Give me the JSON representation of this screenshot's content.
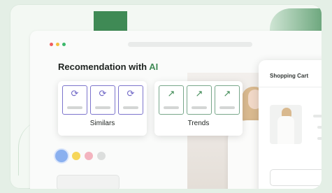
{
  "headline": {
    "prefix": "Recomendation with ",
    "accent": "AI"
  },
  "colors": {
    "accent": "#3f8a55",
    "tile_border": "#7c74cc",
    "refresh_icon": "#6f67c6",
    "trend_border": "#78a78a",
    "trend_icon": "#3f8a55",
    "dot_red": "#f05d5e",
    "dot_yellow": "#f4c13d",
    "dot_green": "#3bb86b"
  },
  "cards": [
    {
      "label": "Similars",
      "icon": "refresh-icon",
      "tile_count": 3
    },
    {
      "label": "Trends",
      "icon": "trend-up-icon",
      "tile_count": 3
    }
  ],
  "color_options": [
    "#8ab0ef",
    "#f6d65a",
    "#f3b4bf",
    "#dcdedd"
  ],
  "cart": {
    "title": "Shopping Cart",
    "pay_icon": "apple-pay-icon"
  }
}
